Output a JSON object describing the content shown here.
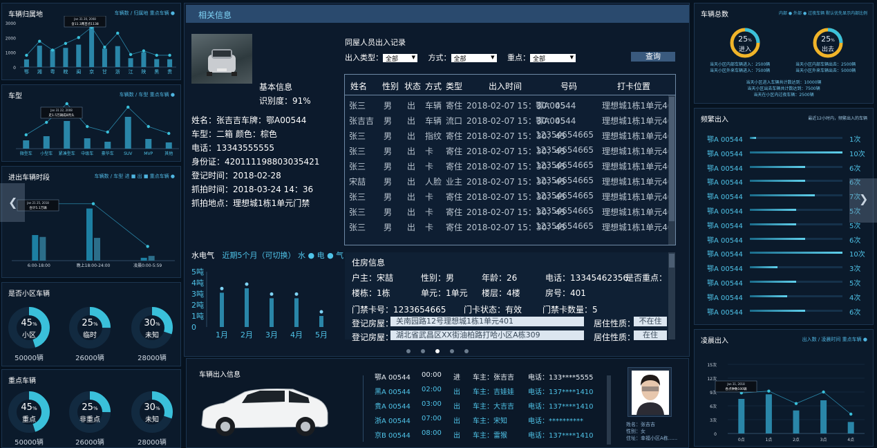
{
  "left": {
    "origin": {
      "title": "车辆归属地",
      "nav": "车辆数 / 归属地     重点车辆 ●",
      "tooltip_date": "Jan 31 20, 2008",
      "tooltip_text": "含11.3两百点1138",
      "yticks": [
        "3000",
        "2000",
        "1000",
        "0"
      ],
      "categories": [
        "鄂",
        "湘",
        "粤",
        "皖",
        "闽",
        "京",
        "甘",
        "浙",
        "江",
        "陕",
        "黑",
        "贵"
      ],
      "bars": [
        520,
        1450,
        1180,
        1300,
        1520,
        2750,
        1250,
        1420,
        600,
        1000,
        540,
        530
      ],
      "line": [
        800,
        1750,
        1150,
        1600,
        2000,
        2700,
        1350,
        2300,
        850,
        1100,
        800,
        800
      ]
    },
    "type": {
      "title": "车型",
      "nav": "车辆数 / 车型     重点车辆 ●",
      "tooltip_date": "Jan 31 22, 2008",
      "tooltip_text": "走1.5万辆成8月头",
      "categories": [
        "微型车",
        "小型车",
        "紧凑型车",
        "中级车",
        "豪华车",
        "SUV",
        "MVP",
        "其他"
      ],
      "bars": [
        12,
        18,
        40,
        15,
        10,
        46,
        14,
        9
      ],
      "line": [
        20,
        38,
        65,
        32,
        24,
        60,
        32,
        22
      ]
    },
    "period": {
      "title": "进出车辆时段",
      "nav": "车辆数 / 车型   进 ■ 出 ■     重点车辆 ●",
      "tooltip_date": "Jan 21 25, 2018",
      "tooltip_text": "合计5.1万辆",
      "categories": [
        "6:00-18:00",
        "晚上18:00-24:00",
        "凌晨0:00-5:59"
      ],
      "in_vals": [
        50,
        48,
        10
      ],
      "out_vals": [
        54,
        110,
        6
      ],
      "line": [
        120,
        120,
        30
      ]
    },
    "community": {
      "title": "是否小区车辆",
      "gauges": [
        {
          "pct": "45",
          "unit": "%",
          "label": "小区",
          "count": "50000辆",
          "frac": 0.45
        },
        {
          "pct": "25",
          "unit": "%",
          "label": "临时",
          "count": "26000辆",
          "frac": 0.25
        },
        {
          "pct": "30",
          "unit": "%",
          "label": "未知",
          "count": "28000辆",
          "frac": 0.3
        }
      ]
    },
    "key": {
      "title": "重点车辆",
      "gauges": [
        {
          "pct": "45",
          "unit": "%",
          "label": "重点",
          "count": "50000辆",
          "frac": 0.45
        },
        {
          "pct": "25",
          "unit": "%",
          "label": "非重点",
          "count": "26000辆",
          "frac": 0.25
        },
        {
          "pct": "30",
          "unit": "%",
          "label": "未知",
          "count": "28000辆",
          "frac": 0.3
        }
      ]
    }
  },
  "center": {
    "header": "相关信息",
    "basic": {
      "title": "基本信息",
      "rate": "识别度：91%",
      "lines": [
        "姓名：张吉吉车牌：鄂A00544",
        "车型：二箱  颜色：棕色",
        "电话：13343555555",
        "身份证：420111198803035421",
        "登记时间：2018-02-28",
        "抓拍时间：2018-03-24  14：36",
        "抓拍地点：理想城1栋1单元门禁"
      ]
    },
    "records": {
      "title": "同屋人员出入记录",
      "filter_type": "出入类型：",
      "filter_method": "方式：",
      "filter_key": "重点：",
      "opt": "全部",
      "query": "查询",
      "headers": [
        "姓名",
        "性别",
        "状态",
        "方式",
        "类型",
        "出入时间",
        "号码",
        "打卡位置"
      ],
      "rows": [
        [
          "张三",
          "男",
          "出",
          "车辆",
          "寄住",
          "2018-02-07  15：30：45",
          "鄂A00544",
          "理想城1栋1单元401"
        ],
        [
          "张吉吉",
          "男",
          "出",
          "车辆",
          "流口",
          "2018-02-07  15：30：45",
          "鄂A00544",
          "理想城1栋1单元401"
        ],
        [
          "张三",
          "男",
          "出",
          "指纹",
          "寄住",
          "2018-02-07  15：30：45",
          "12354654665",
          "理想城1栋1单元401"
        ],
        [
          "张三",
          "男",
          "出",
          "卡",
          "寄住",
          "2018-02-07  15：30：45",
          "12354654665",
          "理想城1栋1单元401"
        ],
        [
          "张三",
          "男",
          "出",
          "卡",
          "寄住",
          "2018-02-07  15：30：45",
          "12354654665",
          "理想城1栋1单元401"
        ],
        [
          "宋喆",
          "男",
          "出",
          "人脸",
          "业主",
          "2018-02-07  15：30：45",
          "12354654665",
          "理想城1栋1单元401"
        ],
        [
          "张三",
          "男",
          "出",
          "卡",
          "寄住",
          "2018-02-07  15：30：45",
          "12354654665",
          "理想城1栋1单元401"
        ],
        [
          "张三",
          "男",
          "出",
          "卡",
          "寄住",
          "2018-02-07  15：30：45",
          "12354654665",
          "理想城1栋1单元401"
        ],
        [
          "张三",
          "男",
          "出",
          "卡",
          "寄住",
          "2018-02-07  15：30：45",
          "12354654665",
          "理想城1栋1单元401"
        ]
      ]
    },
    "utility": {
      "title": "水电气",
      "subtitle": "近期5个月（可切换）",
      "legend": "水 ● 电 ● 气 ●",
      "yticks": [
        "5吨",
        "4吨",
        "3吨",
        "2吨",
        "1吨",
        "0"
      ],
      "categories": [
        "1月",
        "2月",
        "3月",
        "4月",
        "5月"
      ],
      "values": [
        3.1,
        3.5,
        2.6,
        2.6,
        1.0
      ]
    },
    "housing": {
      "title": "住房信息",
      "owner": "户主：宋喆",
      "gender": "性别：男",
      "age": "年龄：26",
      "phone": "电话：13345462356",
      "is_key": "是否重点：",
      "building": "楼栋：1栋",
      "unit": "单元：1单元",
      "floor": "楼层：4楼",
      "room": "房号：401",
      "card": "门禁卡号：1233654665",
      "card_state": "门卡状态：有效",
      "card_count": "门禁卡数量：5",
      "reg_label": "登记房屋：",
      "reg1": "关南园路12号理想城1栋1单元401",
      "reg2": "湖北省武昌区XX街油柏路打哈小区A栋309",
      "res_label": "居住性质：",
      "res1": "不在住",
      "res2": "在住"
    }
  },
  "bottom": {
    "title": "车辆出入信息",
    "rows": [
      [
        "鄂A 00544",
        "00:00",
        "进",
        "车主：张吉吉",
        "电话：133****5555"
      ],
      [
        "黑A 00544",
        "02:00",
        "出",
        "车主：吉娃娃",
        "电话：137****1410"
      ],
      [
        "贵A 00544",
        "03:00",
        "出",
        "车主：大吉吉",
        "电话：137****1410"
      ],
      [
        "浙A 00544",
        "07:00",
        "出",
        "车主：宋知",
        "电话：**********"
      ],
      [
        "京B 00544",
        "08:00",
        "出",
        "车主：雷猴",
        "电话：137****1410"
      ]
    ],
    "person": {
      "name": "姓名：张吉吉",
      "gender": "性别：女",
      "addr": "住址：幸福小区A栋......"
    }
  },
  "right": {
    "total": {
      "title": "车辆总数",
      "nav": "内部 ● 外部 ● 过夜车辆     默认优先显示内部比例",
      "in_pct": "25",
      "in_label": "进入",
      "out_pct": "25",
      "out_label": "出去",
      "in_stats": [
        "当天小区内部车辆进入：2500辆",
        "当天小区外来车辆进入：7500辆"
      ],
      "out_stats": [
        "当天小区内部车辆出去：2500辆",
        "当天小区外来车辆出去：5000辆"
      ],
      "summary": [
        "当天小区进入车辆共计数达到：10000辆",
        "当天小区出去车辆共计数达到：7500辆",
        "当天在小区内过夜车辆：2500辆"
      ]
    },
    "frequent": {
      "title": "频繁出入",
      "nav": "最近12小时内，频繁出入的车辆",
      "items": [
        [
          "鄂A 00544",
          "1次",
          0.07
        ],
        [
          "鄂A 00544",
          "10次",
          1.0
        ],
        [
          "鄂A 00544",
          "6次",
          0.6
        ],
        [
          "鄂A 00544",
          "6次",
          0.6
        ],
        [
          "鄂A 00544",
          "7次",
          0.7
        ],
        [
          "鄂A 00544",
          "5次",
          0.5
        ],
        [
          "鄂A 00544",
          "5次",
          0.5
        ],
        [
          "鄂A 00544",
          "6次",
          0.6
        ],
        [
          "鄂A 00544",
          "10次",
          1.0
        ],
        [
          "鄂A 00544",
          "3次",
          0.3
        ],
        [
          "鄂A 00544",
          "5次",
          0.5
        ],
        [
          "鄂A 00544",
          "4次",
          0.4
        ],
        [
          "鄂A 00544",
          "6次",
          0.6
        ]
      ]
    },
    "dawn": {
      "title": "凌晨出入",
      "nav": "出入数 / 凌晨时间     重点车辆 ●",
      "tooltip_date": "Jan 31, 2018",
      "tooltip_text": "各点钟数100辆",
      "yticks": [
        "15次",
        "12次",
        "9次",
        "6次",
        "3次",
        "0"
      ],
      "categories": [
        "0点",
        "1点",
        "2点",
        "3点",
        "4点"
      ],
      "bars": [
        7.5,
        8.5,
        5,
        7.2,
        2.5
      ],
      "line": [
        8.8,
        9.2,
        6.5,
        9,
        4.2
      ]
    }
  }
}
